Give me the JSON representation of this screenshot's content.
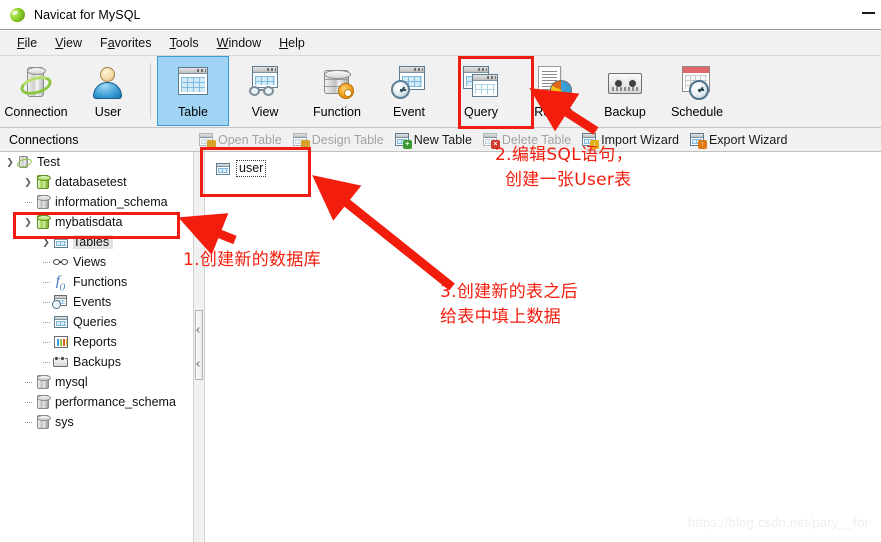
{
  "window": {
    "title": "Navicat for MySQL",
    "app_icon": "navicat-logo-icon",
    "minimize_label": "—"
  },
  "menubar": {
    "items": [
      {
        "label": "File",
        "mnemonic": "F"
      },
      {
        "label": "View",
        "mnemonic": "V"
      },
      {
        "label": "Favorites",
        "mnemonic": "a"
      },
      {
        "label": "Tools",
        "mnemonic": "T"
      },
      {
        "label": "Window",
        "mnemonic": "W"
      },
      {
        "label": "Help",
        "mnemonic": "H"
      }
    ]
  },
  "toolbar": {
    "groups": [
      {
        "buttons": [
          {
            "label": "Connection",
            "icon": "connection-icon",
            "selected": false
          },
          {
            "label": "User",
            "icon": "user-icon",
            "selected": false
          }
        ]
      },
      {
        "buttons": [
          {
            "label": "Table",
            "icon": "table-icon",
            "selected": true
          },
          {
            "label": "View",
            "icon": "view-icon",
            "selected": false
          },
          {
            "label": "Function",
            "icon": "function-icon",
            "selected": false
          },
          {
            "label": "Event",
            "icon": "event-icon",
            "selected": false
          },
          {
            "label": "Query",
            "icon": "query-icon",
            "selected": false
          },
          {
            "label": "Report",
            "icon": "report-icon",
            "selected": false
          },
          {
            "label": "Backup",
            "icon": "backup-icon",
            "selected": false
          },
          {
            "label": "Schedule",
            "icon": "schedule-icon",
            "selected": false
          }
        ]
      }
    ]
  },
  "subbar": {
    "connections_label": "Connections",
    "actions": [
      {
        "label": "Open Table",
        "icon": "open-table-icon",
        "disabled": true,
        "badge": "pencil"
      },
      {
        "label": "Design Table",
        "icon": "design-table-icon",
        "disabled": true,
        "badge": "pencil"
      },
      {
        "label": "New Table",
        "icon": "new-table-icon",
        "disabled": false,
        "badge": "green"
      },
      {
        "label": "Delete Table",
        "icon": "delete-table-icon",
        "disabled": true,
        "badge": "red"
      },
      {
        "label": "Import Wizard",
        "icon": "import-wizard-icon",
        "disabled": false,
        "badge": "yellow"
      },
      {
        "label": "Export Wizard",
        "icon": "export-wizard-icon",
        "disabled": false,
        "badge": "orange"
      }
    ]
  },
  "tree": {
    "nodes": [
      {
        "label": "Test",
        "icon": "connection-node-icon",
        "depth": 0,
        "twisty": "expanded",
        "selected": false
      },
      {
        "label": "databasetest",
        "icon": "database-icon",
        "depth": 1,
        "twisty": "collapsed",
        "selected": false
      },
      {
        "label": "information_schema",
        "icon": "database-gray-icon",
        "depth": 1,
        "twisty": "none",
        "selected": false
      },
      {
        "label": "mybatisdata",
        "icon": "database-icon",
        "depth": 1,
        "twisty": "expanded",
        "selected": false
      },
      {
        "label": "Tables",
        "icon": "tables-icon",
        "depth": 2,
        "twisty": "collapsed",
        "selected": true
      },
      {
        "label": "Views",
        "icon": "views-icon",
        "depth": 2,
        "twisty": "none",
        "selected": false
      },
      {
        "label": "Functions",
        "icon": "functions-icon",
        "depth": 2,
        "twisty": "none",
        "selected": false
      },
      {
        "label": "Events",
        "icon": "events-icon",
        "depth": 2,
        "twisty": "none",
        "selected": false
      },
      {
        "label": "Queries",
        "icon": "queries-icon",
        "depth": 2,
        "twisty": "none",
        "selected": false
      },
      {
        "label": "Reports",
        "icon": "reports-icon",
        "depth": 2,
        "twisty": "none",
        "selected": false
      },
      {
        "label": "Backups",
        "icon": "backups-icon",
        "depth": 2,
        "twisty": "none",
        "selected": false
      },
      {
        "label": "mysql",
        "icon": "database-gray-icon",
        "depth": 1,
        "twisty": "none",
        "selected": false
      },
      {
        "label": "performance_schema",
        "icon": "database-gray-icon",
        "depth": 1,
        "twisty": "none",
        "selected": false
      },
      {
        "label": "sys",
        "icon": "database-gray-icon",
        "depth": 1,
        "twisty": "none",
        "selected": false
      }
    ]
  },
  "main": {
    "objects": [
      {
        "label": "user",
        "icon": "table-object-icon",
        "renaming": true
      }
    ]
  },
  "annotations": {
    "color": "#f21d0d",
    "texts": [
      {
        "id": "note-1",
        "text": "1.创建新的数据库"
      },
      {
        "id": "note-2-line1",
        "text": "2.编辑SQL语句，"
      },
      {
        "id": "note-2-line2",
        "text": "创建一张User表"
      },
      {
        "id": "note-3-line1",
        "text": "3.创建新的表之后"
      },
      {
        "id": "note-3-line2",
        "text": "给表中填上数据"
      }
    ],
    "boxes": [
      {
        "id": "box-query-button"
      },
      {
        "id": "box-user-table"
      },
      {
        "id": "box-mybatisdata-node"
      }
    ],
    "arrows": [
      {
        "id": "arrow-to-query-button"
      },
      {
        "id": "arrow-to-user-table"
      },
      {
        "id": "arrow-to-mybatisdata-node"
      }
    ]
  },
  "watermark": {
    "text": "https://blog.csdn.net/pary__for"
  }
}
